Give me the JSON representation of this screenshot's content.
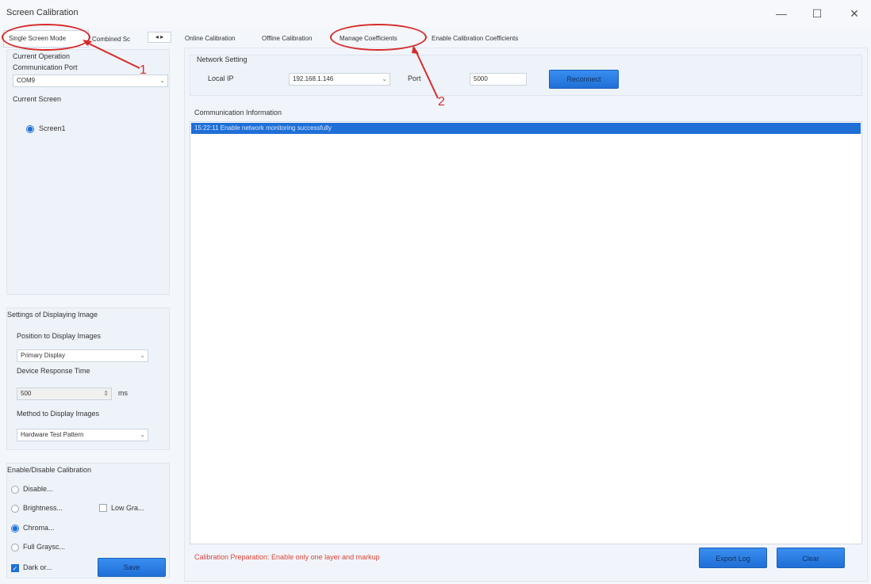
{
  "window": {
    "title": "Screen Calibration",
    "minimize": "—",
    "maximize": "☐",
    "close": "✕"
  },
  "left_tabs": {
    "single": "Single Screen Mode",
    "combined": "Combined Sc",
    "nav": "◂ ▸"
  },
  "left": {
    "current_operation": "Current Operation",
    "comm_port_label": "Communication Port",
    "comm_port_value": "COM9",
    "current_screen_label": "Current Screen",
    "screen1": "Screen1"
  },
  "display_settings": {
    "title": "Settings of Displaying Image",
    "position_label": "Position to Display Images",
    "position_value": "Primary Display",
    "response_label": "Device Response Time",
    "response_value": "500",
    "response_unit": "ms",
    "method_label": "Method to Display Images",
    "method_value": "Hardware Test Pattern"
  },
  "enable_calib": {
    "title": "Enable/Disable Calibration",
    "disable": "Disable...",
    "brightness": "Brightness...",
    "low_gray": "Low Gra...",
    "chroma": "Chroma...",
    "full_gray": "Full Graysc...",
    "dark_or": "Dark or...",
    "save": "Save"
  },
  "right_tabs": {
    "online": "Online Calibration",
    "offline": "Offline Calibration",
    "manage": "Manage Coefficients",
    "enable": "Enable Calibration Coefficients"
  },
  "network": {
    "title": "Network Setting",
    "local_ip_label": "Local IP",
    "local_ip_value": "192.168.1.146",
    "port_label": "Port",
    "port_value": "5000",
    "reconnect": "Reconnect"
  },
  "comm_info": {
    "title": "Communication Information",
    "log_line": "15:22:11 Enable network monitoring successfully"
  },
  "footer": {
    "warning": "Calibration Preparation: Enable only one layer and markup",
    "export": "Export Log",
    "clear": "Clear"
  },
  "annotations": {
    "one": "1",
    "two": "2"
  },
  "colors": {
    "accent": "#1f6fd6",
    "annotation": "#d62a2a",
    "warning_text": "#d9453a"
  }
}
